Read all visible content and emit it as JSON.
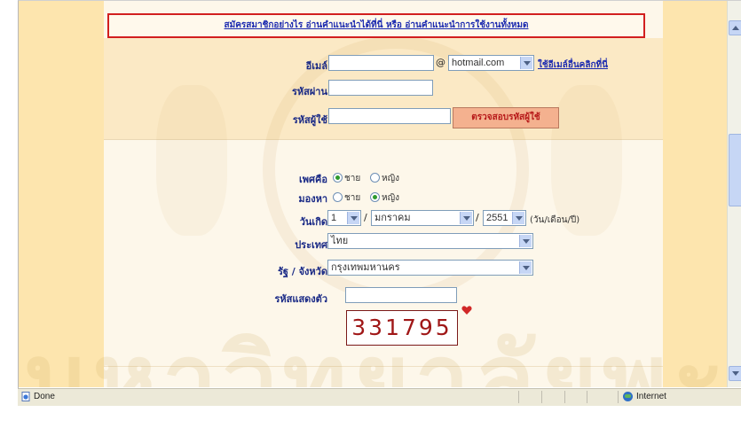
{
  "notice": {
    "text": "สมัครสมาชิกอย่างไร อ่านคำแนะนำได้ที่นี่ หรือ อ่านคำแนะนำการใช้งานทั้งหมด"
  },
  "form": {
    "email": {
      "label": "อีเมล์",
      "value": "",
      "at": "@",
      "domain_value": "hotmail.com",
      "alt_link": "ใช้อีเมล์อื่นคลิกที่นี่"
    },
    "password": {
      "label": "รหัสผ่าน",
      "value": ""
    },
    "userid": {
      "label": "รหัสผู้ใช้",
      "value": "",
      "check_button": "ตรวจสอบรหัสผู้ใช้"
    },
    "gender": {
      "label": "เพศคือ",
      "options": [
        "ชาย",
        "หญิง"
      ],
      "selected": "ชาย"
    },
    "looking_for": {
      "label": "มองหา",
      "options": [
        "ชาย",
        "หญิง"
      ],
      "selected": "หญิง"
    },
    "birthdate": {
      "label": "วันเกิด",
      "day": "1",
      "month": "มกราคม",
      "year": "2551",
      "sep": "/",
      "hint": "(วัน/เดือน/ปี)"
    },
    "country": {
      "label": "ประเทศ",
      "value": "ไทย"
    },
    "province": {
      "label": "รัฐ / จังหวัด",
      "value": "กรุงเทพมหานคร"
    },
    "captcha_code": {
      "label": "รหัสแสดงตัว",
      "value": ""
    },
    "captcha": {
      "image_text": "331795"
    }
  },
  "statusbar": {
    "status": "Done",
    "zone": "Internet"
  },
  "watermark": {
    "text": "มหาวิทยาลัยพะเยา"
  },
  "colors": {
    "label": "#1a2a86",
    "accent_red": "#d21f1f",
    "strip": "#fde5ae"
  }
}
